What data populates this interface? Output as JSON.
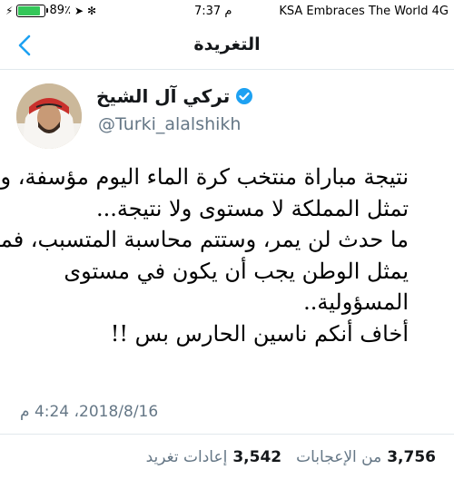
{
  "status_bar": {
    "carrier": "KSA Embraces The World",
    "network": "4G",
    "time": "7:37 م",
    "battery_percent": "89٪",
    "battery_level": 0.89
  },
  "nav": {
    "title": "التغريدة",
    "back_icon": "chevron-left-icon"
  },
  "author": {
    "display_name": "تركي آل الشيخ",
    "handle": "@Turki_alalshikh",
    "verified": true
  },
  "tweet": {
    "lines": [
      "نتيجة مباراة منتخب كرة الماء اليوم  مؤسفة، ولا",
      "تمثل المملكة لا مستوى ولا نتيجة...",
      "ما حدث لن يمر، وستتم محاسبة المتسبب، فمن",
      "يمثل الوطن يجب أن يكون في مستوى",
      "المسؤولية..",
      "أخاف أنكم ناسين الحارس بس !!"
    ],
    "timestamp": "2018/8/16، 4:24 م"
  },
  "stats": {
    "retweets_count": "3,542",
    "retweets_label": "إعادات تغريد",
    "likes_count": "3,756",
    "likes_label": "من الإعجابات"
  },
  "colors": {
    "accent": "#1da1f2",
    "muted": "#657786",
    "divider": "#e1e8ed",
    "battery": "#34c759"
  }
}
